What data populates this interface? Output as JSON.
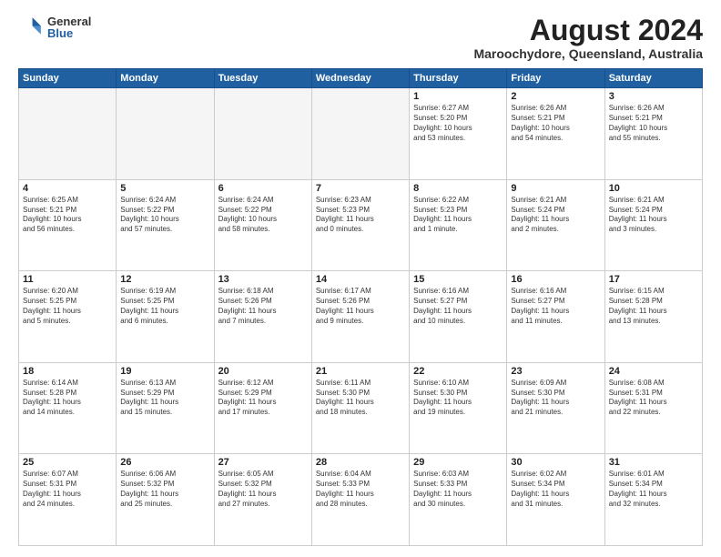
{
  "header": {
    "logo_general": "General",
    "logo_blue": "Blue",
    "month_year": "August 2024",
    "location": "Maroochydore, Queensland, Australia"
  },
  "days_of_week": [
    "Sunday",
    "Monday",
    "Tuesday",
    "Wednesday",
    "Thursday",
    "Friday",
    "Saturday"
  ],
  "weeks": [
    [
      {
        "day": "",
        "info": "",
        "empty": true
      },
      {
        "day": "",
        "info": "",
        "empty": true
      },
      {
        "day": "",
        "info": "",
        "empty": true
      },
      {
        "day": "",
        "info": "",
        "empty": true
      },
      {
        "day": "1",
        "info": "Sunrise: 6:27 AM\nSunset: 5:20 PM\nDaylight: 10 hours\nand 53 minutes."
      },
      {
        "day": "2",
        "info": "Sunrise: 6:26 AM\nSunset: 5:21 PM\nDaylight: 10 hours\nand 54 minutes."
      },
      {
        "day": "3",
        "info": "Sunrise: 6:26 AM\nSunset: 5:21 PM\nDaylight: 10 hours\nand 55 minutes."
      }
    ],
    [
      {
        "day": "4",
        "info": "Sunrise: 6:25 AM\nSunset: 5:21 PM\nDaylight: 10 hours\nand 56 minutes."
      },
      {
        "day": "5",
        "info": "Sunrise: 6:24 AM\nSunset: 5:22 PM\nDaylight: 10 hours\nand 57 minutes."
      },
      {
        "day": "6",
        "info": "Sunrise: 6:24 AM\nSunset: 5:22 PM\nDaylight: 10 hours\nand 58 minutes."
      },
      {
        "day": "7",
        "info": "Sunrise: 6:23 AM\nSunset: 5:23 PM\nDaylight: 11 hours\nand 0 minutes."
      },
      {
        "day": "8",
        "info": "Sunrise: 6:22 AM\nSunset: 5:23 PM\nDaylight: 11 hours\nand 1 minute."
      },
      {
        "day": "9",
        "info": "Sunrise: 6:21 AM\nSunset: 5:24 PM\nDaylight: 11 hours\nand 2 minutes."
      },
      {
        "day": "10",
        "info": "Sunrise: 6:21 AM\nSunset: 5:24 PM\nDaylight: 11 hours\nand 3 minutes."
      }
    ],
    [
      {
        "day": "11",
        "info": "Sunrise: 6:20 AM\nSunset: 5:25 PM\nDaylight: 11 hours\nand 5 minutes."
      },
      {
        "day": "12",
        "info": "Sunrise: 6:19 AM\nSunset: 5:25 PM\nDaylight: 11 hours\nand 6 minutes."
      },
      {
        "day": "13",
        "info": "Sunrise: 6:18 AM\nSunset: 5:26 PM\nDaylight: 11 hours\nand 7 minutes."
      },
      {
        "day": "14",
        "info": "Sunrise: 6:17 AM\nSunset: 5:26 PM\nDaylight: 11 hours\nand 9 minutes."
      },
      {
        "day": "15",
        "info": "Sunrise: 6:16 AM\nSunset: 5:27 PM\nDaylight: 11 hours\nand 10 minutes."
      },
      {
        "day": "16",
        "info": "Sunrise: 6:16 AM\nSunset: 5:27 PM\nDaylight: 11 hours\nand 11 minutes."
      },
      {
        "day": "17",
        "info": "Sunrise: 6:15 AM\nSunset: 5:28 PM\nDaylight: 11 hours\nand 13 minutes."
      }
    ],
    [
      {
        "day": "18",
        "info": "Sunrise: 6:14 AM\nSunset: 5:28 PM\nDaylight: 11 hours\nand 14 minutes."
      },
      {
        "day": "19",
        "info": "Sunrise: 6:13 AM\nSunset: 5:29 PM\nDaylight: 11 hours\nand 15 minutes."
      },
      {
        "day": "20",
        "info": "Sunrise: 6:12 AM\nSunset: 5:29 PM\nDaylight: 11 hours\nand 17 minutes."
      },
      {
        "day": "21",
        "info": "Sunrise: 6:11 AM\nSunset: 5:30 PM\nDaylight: 11 hours\nand 18 minutes."
      },
      {
        "day": "22",
        "info": "Sunrise: 6:10 AM\nSunset: 5:30 PM\nDaylight: 11 hours\nand 19 minutes."
      },
      {
        "day": "23",
        "info": "Sunrise: 6:09 AM\nSunset: 5:30 PM\nDaylight: 11 hours\nand 21 minutes."
      },
      {
        "day": "24",
        "info": "Sunrise: 6:08 AM\nSunset: 5:31 PM\nDaylight: 11 hours\nand 22 minutes."
      }
    ],
    [
      {
        "day": "25",
        "info": "Sunrise: 6:07 AM\nSunset: 5:31 PM\nDaylight: 11 hours\nand 24 minutes."
      },
      {
        "day": "26",
        "info": "Sunrise: 6:06 AM\nSunset: 5:32 PM\nDaylight: 11 hours\nand 25 minutes."
      },
      {
        "day": "27",
        "info": "Sunrise: 6:05 AM\nSunset: 5:32 PM\nDaylight: 11 hours\nand 27 minutes."
      },
      {
        "day": "28",
        "info": "Sunrise: 6:04 AM\nSunset: 5:33 PM\nDaylight: 11 hours\nand 28 minutes."
      },
      {
        "day": "29",
        "info": "Sunrise: 6:03 AM\nSunset: 5:33 PM\nDaylight: 11 hours\nand 30 minutes."
      },
      {
        "day": "30",
        "info": "Sunrise: 6:02 AM\nSunset: 5:34 PM\nDaylight: 11 hours\nand 31 minutes."
      },
      {
        "day": "31",
        "info": "Sunrise: 6:01 AM\nSunset: 5:34 PM\nDaylight: 11 hours\nand 32 minutes."
      }
    ]
  ]
}
